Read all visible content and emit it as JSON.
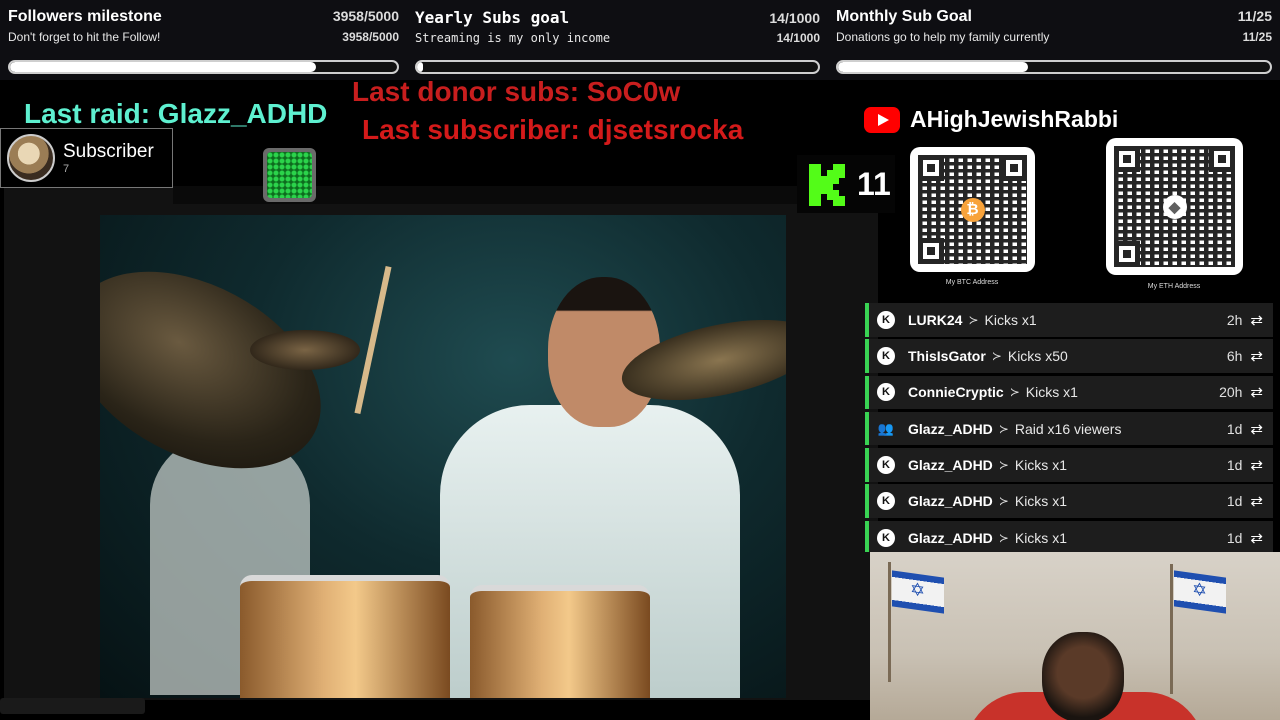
{
  "goals": {
    "followers": {
      "title": "Followers milestone",
      "subtitle": "Don't forget to hit the Follow!",
      "count": "3958/5000",
      "progress": 0.7916
    },
    "yearly": {
      "title": "Yearly Subs goal",
      "subtitle": "Streaming is my only income",
      "count": "14/1000",
      "progress": 0.014
    },
    "monthly": {
      "title": "Monthly Sub Goal",
      "subtitle": "Donations go to help my family currently",
      "count": "11/25",
      "progress": 0.44
    }
  },
  "banners": {
    "raid": "Last raid: Glazz_ADHD",
    "donor": "Last donor subs: SoC0w",
    "subscriber": "Last subscriber: djsetsrocka"
  },
  "sub_badge": {
    "label": "Subscriber",
    "count": "7"
  },
  "kick": {
    "count": "11"
  },
  "channel": {
    "name": "AHighJewishRabbi"
  },
  "qr": {
    "btc_caption": "My BTC Address",
    "eth_caption": "My ETH Address"
  },
  "events": [
    {
      "user": "LURK24",
      "sep": "≻",
      "what": "Kicks x1",
      "time": "2h",
      "type": "kick"
    },
    {
      "user": "ThisIsGator",
      "sep": "≻",
      "what": "Kicks x50",
      "time": "6h",
      "type": "kick"
    },
    {
      "user": "ConnieCryptic",
      "sep": "≻",
      "what": "Kicks x1",
      "time": "20h",
      "type": "kick"
    },
    {
      "user": "Glazz_ADHD",
      "sep": "≻",
      "what": "Raid x16 viewers",
      "time": "1d",
      "type": "raid"
    },
    {
      "user": "Glazz_ADHD",
      "sep": "≻",
      "what": "Kicks x1",
      "time": "1d",
      "type": "kick"
    },
    {
      "user": "Glazz_ADHD",
      "sep": "≻",
      "what": "Kicks x1",
      "time": "1d",
      "type": "kick"
    },
    {
      "user": "Glazz_ADHD",
      "sep": "≻",
      "what": "Kicks x1",
      "time": "1d",
      "type": "kick"
    }
  ],
  "colors": {
    "kick_green": "#53fc18",
    "raid_text": "#5ef0d0",
    "donor_red": "#c81e1e",
    "event_accent": "#39d353",
    "youtube_red": "#ff0000"
  },
  "icons": {
    "replay": "replay-icon",
    "kick": "kick-icon",
    "raid": "raid-icon",
    "youtube": "youtube-icon",
    "bitcoin": "bitcoin-icon",
    "ethereum": "ethereum-icon"
  }
}
